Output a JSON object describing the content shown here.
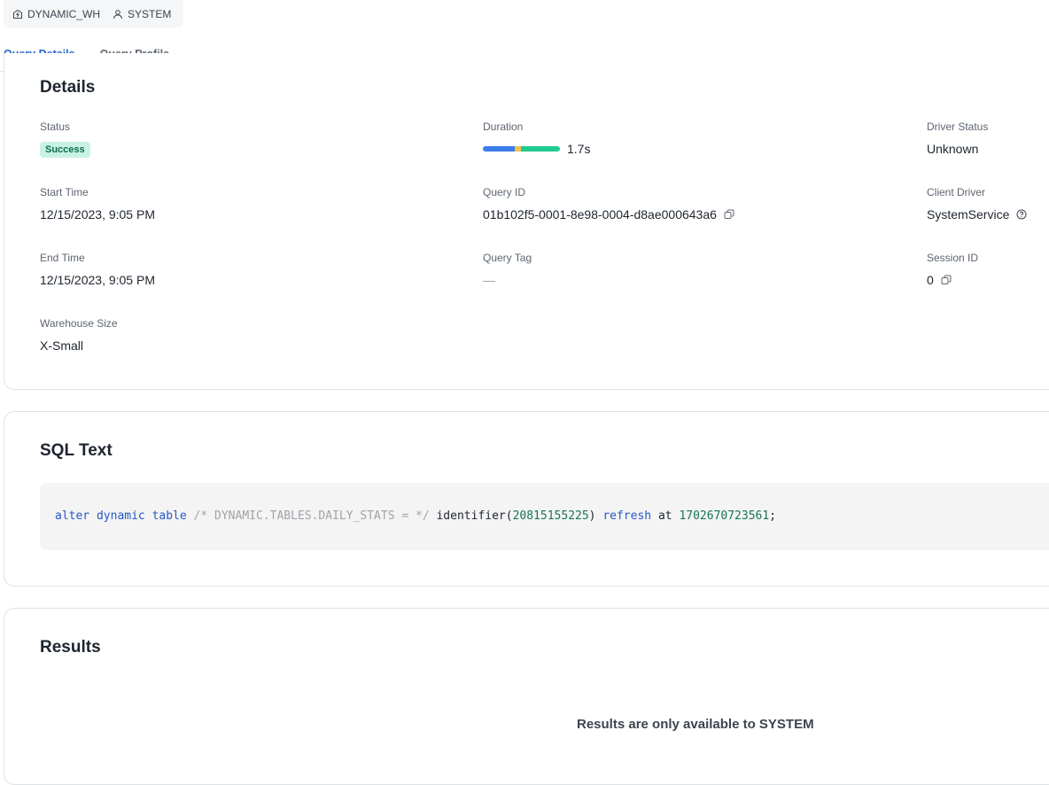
{
  "header": {
    "warehouse": "DYNAMIC_WH",
    "warehouse_icon": "warehouse-icon",
    "user": "SYSTEM",
    "user_icon": "user-icon"
  },
  "tabs": [
    {
      "label": "Query Details",
      "active": true
    },
    {
      "label": "Query Profile",
      "active": false
    }
  ],
  "details": {
    "title": "Details",
    "status": {
      "label": "Status",
      "value": "Success",
      "color": "#c8f3e3"
    },
    "duration": {
      "label": "Duration",
      "value": "1.7s",
      "segments": [
        {
          "fraction": 0.41,
          "color": "#3b7de9"
        },
        {
          "fraction": 0.09,
          "color": "#f2c14e"
        },
        {
          "fraction": 0.5,
          "color": "#1fcb8e"
        }
      ]
    },
    "driver_status": {
      "label": "Driver Status",
      "value": "Unknown"
    },
    "start_time": {
      "label": "Start Time",
      "value": "12/15/2023, 9:05 PM"
    },
    "query_id": {
      "label": "Query ID",
      "value": "01b102f5-0001-8e98-0004-d8ae000643a6"
    },
    "client_driver": {
      "label": "Client Driver",
      "value": "SystemService"
    },
    "end_time": {
      "label": "End Time",
      "value": "12/15/2023, 9:05 PM"
    },
    "query_tag": {
      "label": "Query Tag",
      "value": "—"
    },
    "session_id": {
      "label": "Session ID",
      "value": "0"
    },
    "warehouse_size": {
      "label": "Warehouse Size",
      "value": "X-Small"
    }
  },
  "sql": {
    "title": "SQL Text",
    "tokens": [
      "alter dynamic table",
      "/* DYNAMIC.TABLES.DAILY_STATS = */",
      "identifier(",
      "20815155225",
      ")",
      "refresh",
      "at",
      "1702670723561",
      ";"
    ]
  },
  "results": {
    "title": "Results",
    "message": "Results are only available to SYSTEM"
  }
}
